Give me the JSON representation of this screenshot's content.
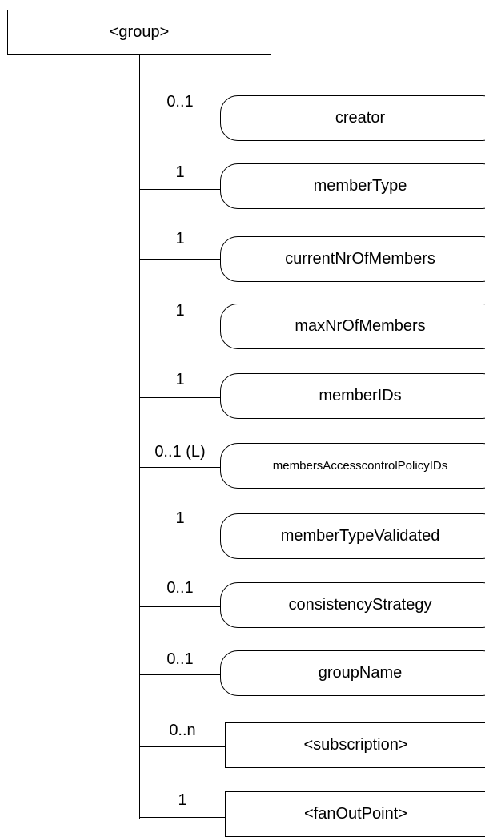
{
  "root": {
    "label": "<group>"
  },
  "attributes": [
    {
      "name": "creator",
      "multiplicity": "0..1"
    },
    {
      "name": "memberType",
      "multiplicity": "1"
    },
    {
      "name": "currentNrOfMembers",
      "multiplicity": "1"
    },
    {
      "name": "maxNrOfMembers",
      "multiplicity": "1"
    },
    {
      "name": "memberIDs",
      "multiplicity": "1"
    },
    {
      "name": "membersAccesscontrolPolicyIDs",
      "multiplicity": "0..1 (L)"
    },
    {
      "name": "memberTypeValidated",
      "multiplicity": "1"
    },
    {
      "name": "consistencyStrategy",
      "multiplicity": "0..1"
    },
    {
      "name": "groupName",
      "multiplicity": "0..1"
    }
  ],
  "child_resources": [
    {
      "name": "<subscription>",
      "multiplicity": "0..n"
    },
    {
      "name": "<fanOutPoint>",
      "multiplicity": "1"
    }
  ]
}
